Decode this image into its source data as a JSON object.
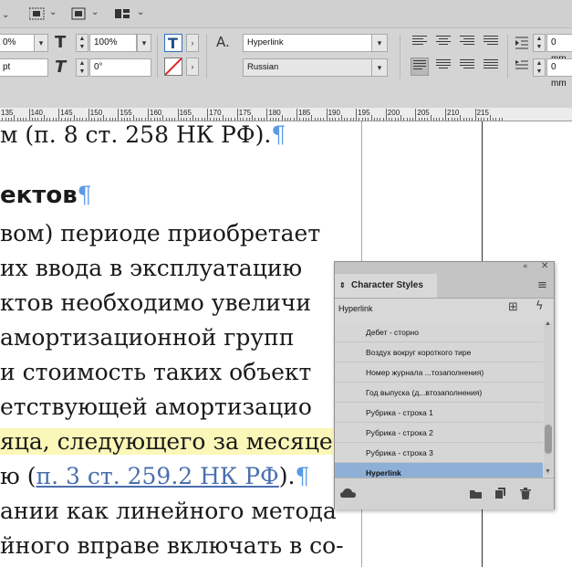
{
  "toolbar": {
    "tracking_value": "0%",
    "hscale_value": "100%",
    "baseline_value": "pt",
    "skew_value": "0°",
    "char_style_value": "Hyperlink",
    "language_value": "Russian",
    "indent_top_value": "0 mm",
    "indent_bottom_value": "0 mm"
  },
  "ruler": {
    "labels": [
      "135",
      "140",
      "145",
      "150",
      "155",
      "160",
      "165",
      "170",
      "175",
      "180",
      "185",
      "190",
      "195",
      "200",
      "205",
      "210",
      "215"
    ]
  },
  "document": {
    "lines": [
      {
        "segments": [
          {
            "t": "м (п. 8 ст. 258 НК РФ)."
          },
          {
            "t": "¶",
            "c": "para"
          }
        ]
      },
      {
        "segments": [
          {
            "t": "ектов",
            "c": "head"
          },
          {
            "t": "¶",
            "c": "para"
          }
        ]
      },
      {
        "segments": [
          {
            "t": "вом) периоде приобретает"
          }
        ]
      },
      {
        "segments": [
          {
            "t": "их ввода в эксплуатацию "
          }
        ]
      },
      {
        "segments": [
          {
            "t": "ктов необходимо увеличи"
          }
        ]
      },
      {
        "segments": [
          {
            "t": "амортизационной групп"
          }
        ]
      },
      {
        "segments": [
          {
            "t": "и стоимость таких объект"
          }
        ]
      },
      {
        "segments": [
          {
            "t": "етствующей амортизацио"
          }
        ]
      },
      {
        "segments": [
          {
            "t": "яца, следующего за месяце",
            "c": "hl"
          }
        ]
      },
      {
        "segments": [
          {
            "t": "ю ("
          },
          {
            "t": "п. 3 ст. 259.2 НК РФ",
            "c": "link"
          },
          {
            "t": ")."
          },
          {
            "t": "¶",
            "c": "para"
          }
        ]
      },
      {
        "segments": [
          {
            "t": "ании как линейного метода"
          }
        ]
      },
      {
        "segments": [
          {
            "t": "йного вправе включать в со-"
          }
        ]
      }
    ]
  },
  "panel": {
    "title": "Character Styles",
    "current_style": "Hyperlink",
    "styles": [
      "Дебет - сторно",
      "Воздух вокруг короткого тире",
      "Номер журнала ...тозаполнения)",
      "Год выпуска (д...втозаполнения)",
      "Рубрика - строка 1",
      "Рубрика - строка 2",
      "Рубрика - строка 3",
      "Hyperlink"
    ],
    "selected_index": 7,
    "scroll_position": 0.82
  },
  "colors": {
    "pilcrow": "#5a9ae6",
    "highlight": "#fbf7b8",
    "link": "#4a6fae",
    "selection": "#8fb0d6"
  }
}
